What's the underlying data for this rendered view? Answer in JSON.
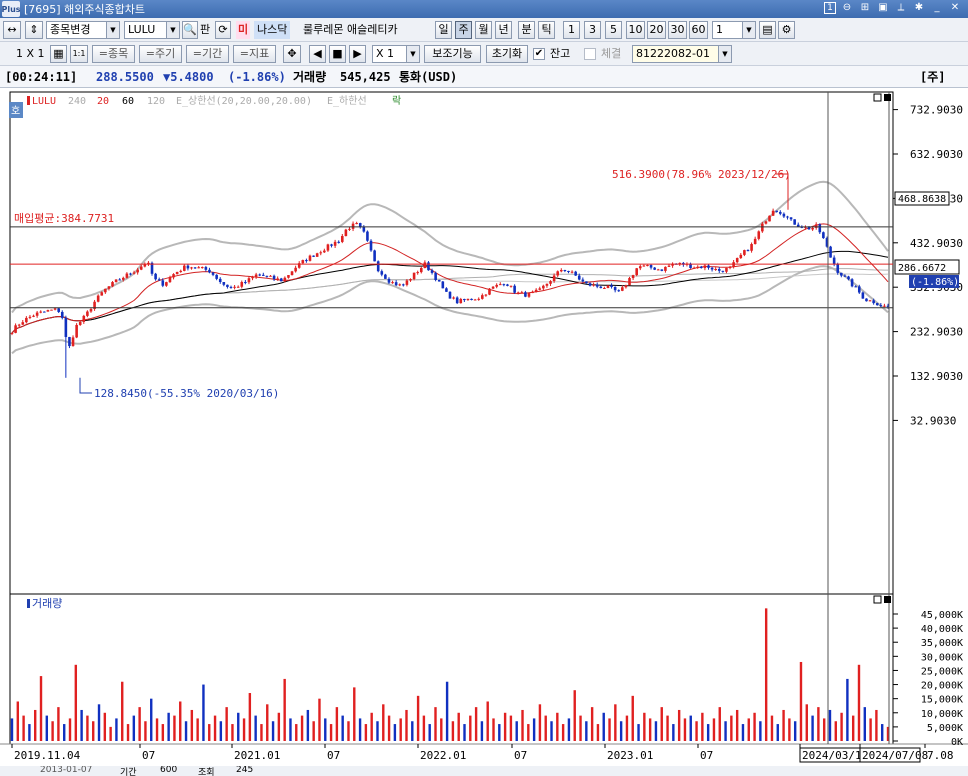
{
  "window": {
    "title": "[7695] 해외주식종합차트",
    "logo": "Plus",
    "sub_badge": "1"
  },
  "toolbar1": {
    "nav_arrows": "↔",
    "updown": "⇕",
    "symbol_mode": "종목변경",
    "symbol": "LULU",
    "pan_label": "판",
    "market_flag": "미",
    "exchange": "나스닥",
    "stock_name": "룰루레몬 애슬레티카",
    "periods": [
      "일",
      "주",
      "월",
      "년",
      "분",
      "틱"
    ],
    "active_period": "주",
    "intervals": [
      "1",
      "3",
      "5",
      "10",
      "20",
      "30",
      "60"
    ],
    "count": "1"
  },
  "toolbar2": {
    "layout": "1 X 1",
    "b_11": "1:1",
    "b_item": "=종목",
    "b_period": "=주기",
    "b_range": "=기간",
    "b_indicator": "=지표",
    "multiplier": "X 1",
    "aux": "보조기능",
    "reset": "초기화",
    "balance_label": "잔고",
    "balance_checked": "✔",
    "exec_label": "체결",
    "account": "81222082-01"
  },
  "info": {
    "time": "[00:24:11]",
    "price": "288.5500",
    "change": "▼5.4800",
    "change_pct": "(-1.86%)",
    "volume_label": "거래량",
    "volume": "545,425",
    "currency": "통화(USD)",
    "side_tag": "[주]"
  },
  "chart_data": {
    "type": "candlestick",
    "title": "",
    "legend": [
      "LULU",
      "240",
      "20",
      "60",
      "120",
      "E_상한선(20,20.00,20.00)",
      "E_하한선",
      "락"
    ],
    "corner_tag": "호",
    "y_ticks": [
      "732.9030",
      "632.9030",
      "532.9030",
      "432.9030",
      "332.9030",
      "232.9030",
      "132.9030",
      "32.9030"
    ],
    "y_tick_values": [
      732.903,
      632.903,
      532.903,
      432.903,
      332.903,
      232.903,
      132.903,
      32.903
    ],
    "x_ticks": [
      "2019.11.04",
      "07",
      "2021.01",
      "07",
      "2022.01",
      "07",
      "2023.01",
      "07",
      "2024/03/11",
      "2024/07/08",
      "7.08"
    ],
    "avg_buy_label": "매입평균:384.7731",
    "avg_buy_price": 384.7731,
    "hline_upper": "468.8638",
    "hline_upper_value": 468.8638,
    "current_label": "286.6672",
    "current_value": 286.6672,
    "current_pct": "(-1.86%)",
    "annot_high": "516.3900(78.96% 2023/12/26)",
    "annot_low": "128.8450(-55.35% 2020/03/16)",
    "annot_low_value": 128.845,
    "annot_high_value": 516.39,
    "volume_title": "거래량",
    "volume_ticks": [
      "45,000K",
      "40,000K",
      "35,000K",
      "30,000K",
      "25,000K",
      "20,000K",
      "15,000K",
      "10,000K",
      "5,000K",
      "0K"
    ],
    "volume_tick_values": [
      45000,
      40000,
      35000,
      30000,
      25000,
      20000,
      15000,
      10000,
      5000,
      0
    ],
    "price_path": [
      [
        0,
        235
      ],
      [
        8,
        255
      ],
      [
        20,
        272
      ],
      [
        32,
        280
      ],
      [
        40,
        283
      ],
      [
        46,
        255
      ],
      [
        48,
        180
      ],
      [
        52,
        215
      ],
      [
        56,
        245
      ],
      [
        64,
        268
      ],
      [
        72,
        300
      ],
      [
        80,
        325
      ],
      [
        90,
        345
      ],
      [
        100,
        360
      ],
      [
        110,
        375
      ],
      [
        118,
        390
      ],
      [
        124,
        350
      ],
      [
        132,
        340
      ],
      [
        142,
        365
      ],
      [
        152,
        380
      ],
      [
        160,
        378
      ],
      [
        172,
        370
      ],
      [
        184,
        340
      ],
      [
        192,
        330
      ],
      [
        204,
        345
      ],
      [
        214,
        362
      ],
      [
        224,
        355
      ],
      [
        236,
        348
      ],
      [
        246,
        375
      ],
      [
        256,
        395
      ],
      [
        266,
        410
      ],
      [
        276,
        425
      ],
      [
        286,
        440
      ],
      [
        292,
        465
      ],
      [
        300,
        475
      ],
      [
        306,
        460
      ],
      [
        312,
        420
      ],
      [
        320,
        370
      ],
      [
        330,
        345
      ],
      [
        340,
        335
      ],
      [
        350,
        360
      ],
      [
        360,
        385
      ],
      [
        368,
        360
      ],
      [
        378,
        320
      ],
      [
        388,
        300
      ],
      [
        398,
        305
      ],
      [
        408,
        310
      ],
      [
        418,
        330
      ],
      [
        430,
        345
      ],
      [
        440,
        320
      ],
      [
        450,
        315
      ],
      [
        460,
        325
      ],
      [
        470,
        350
      ],
      [
        480,
        375
      ],
      [
        490,
        362
      ],
      [
        500,
        340
      ],
      [
        510,
        335
      ],
      [
        520,
        332
      ],
      [
        530,
        320
      ],
      [
        538,
        350
      ],
      [
        546,
        380
      ],
      [
        556,
        378
      ],
      [
        566,
        372
      ],
      [
        576,
        385
      ],
      [
        586,
        385
      ],
      [
        596,
        378
      ],
      [
        606,
        380
      ],
      [
        616,
        370
      ],
      [
        626,
        375
      ],
      [
        636,
        405
      ],
      [
        646,
        430
      ],
      [
        656,
        480
      ],
      [
        664,
        510
      ],
      [
        672,
        500
      ],
      [
        680,
        480
      ],
      [
        688,
        470
      ],
      [
        696,
        465
      ],
      [
        702,
        470
      ],
      [
        708,
        440
      ],
      [
        714,
        400
      ],
      [
        720,
        370
      ],
      [
        728,
        350
      ],
      [
        736,
        330
      ],
      [
        744,
        305
      ],
      [
        752,
        300
      ],
      [
        760,
        290
      ],
      [
        764,
        288.5
      ]
    ],
    "volume_bars": [
      8000,
      14000,
      9000,
      6000,
      11000,
      23000,
      9000,
      7000,
      12000,
      6000,
      8000,
      27000,
      11000,
      9000,
      7000,
      13000,
      10000,
      5000,
      8000,
      21000,
      6000,
      9000,
      12000,
      7000,
      15000,
      8000,
      6000,
      10000,
      9000,
      14000,
      7000,
      11000,
      8000,
      20000,
      6000,
      9000,
      7000,
      12000,
      6000,
      10000,
      8000,
      17000,
      9000,
      6000,
      13000,
      7000,
      10000,
      22000,
      8000,
      6000,
      9000,
      11000,
      7000,
      15000,
      8000,
      6000,
      12000,
      9000,
      7000,
      19000,
      8000,
      6000,
      10000,
      7000,
      13000,
      9000,
      6000,
      8000,
      11000,
      7000,
      16000,
      9000,
      6000,
      12000,
      8000,
      21000,
      7000,
      10000,
      6000,
      9000,
      12000,
      7000,
      14000,
      8000,
      6000,
      10000,
      9000,
      7000,
      11000,
      6000,
      8000,
      13000,
      9000,
      7000,
      10000,
      6000,
      8000,
      18000,
      9000,
      7000,
      12000,
      6000,
      10000,
      8000,
      13000,
      7000,
      9000,
      16000,
      6000,
      10000,
      8000,
      7000,
      12000,
      9000,
      6000,
      11000,
      8000,
      9000,
      7000,
      10000,
      6000,
      8000,
      12000,
      7000,
      9000,
      11000,
      6000,
      8000,
      10000,
      7000,
      47000,
      9000,
      6000,
      11000,
      8000,
      7000,
      28000,
      13000,
      9000,
      12000,
      8000,
      11000,
      7000,
      10000,
      22000,
      9000,
      27000,
      12000,
      8000,
      11000,
      6000,
      5000
    ]
  },
  "bottom": {
    "start_date": "2013-01-07",
    "period_label": "기간",
    "period_val": "600",
    "query_label": "조회",
    "query_val": "245"
  }
}
